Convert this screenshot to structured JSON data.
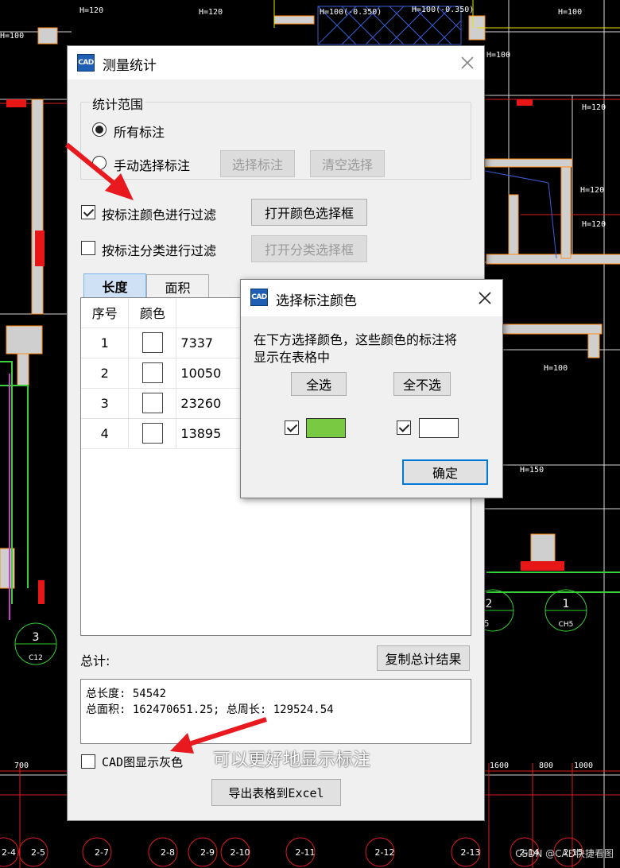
{
  "cad_labels": {
    "h120_a": "H=120",
    "h120_b": "H=120",
    "h100_a": "H=100(-0.350)",
    "h100_b": "H=100(-0.350)",
    "h100_c": "H=100",
    "h100_d": "H=100",
    "h100_e": "H=100",
    "h120_c": "H=120",
    "h120_d": "H=120",
    "h120_e": "H=120",
    "h100_f": "H=100",
    "h150": "H=150",
    "dim_700": "700",
    "dim_1600": "1600",
    "dim_800": "800",
    "dim_1000": "1000",
    "bubble_3": "3",
    "bubble_3_sub": "C12",
    "bubble_1": "1",
    "bubble_1_sub": "CH5",
    "bubble_2": "2",
    "bubble_2_sub": "5",
    "axes": [
      "2-4",
      "2-5",
      "2-7",
      "2-8",
      "2-9",
      "2-10",
      "2-11",
      "2-12",
      "2-13",
      "2-14",
      "2-15"
    ]
  },
  "main_dialog": {
    "icon_text": "CAD",
    "title": "测量统计",
    "scope_group_title": "统计范围",
    "radio_all": "所有标注",
    "radio_manual": "手动选择标注",
    "btn_select": "选择标注",
    "btn_clear": "清空选择",
    "check_color_filter": "按标注颜色进行过滤",
    "btn_open_color": "打开颜色选择框",
    "check_category_filter": "按标注分类进行过滤",
    "btn_open_category": "打开分类选择框",
    "tab_length": "长度",
    "tab_area": "面积",
    "table_headers": {
      "no": "序号",
      "color": "颜色",
      "length": "长度"
    },
    "rows": [
      {
        "no": "1",
        "length": "7337"
      },
      {
        "no": "2",
        "length": "10050"
      },
      {
        "no": "3",
        "length": "23260"
      },
      {
        "no": "4",
        "length": "13895"
      }
    ],
    "total_label": "总计:",
    "btn_copy_total": "复制总计结果",
    "summary_line1": "总长度: 54542",
    "summary_line2": "总面积: 162470651.25; 总周长: 129524.54",
    "check_gray": "CAD图显示灰色",
    "btn_export": "导出表格到Excel"
  },
  "color_dialog": {
    "title": "选择标注颜色",
    "instruction_line1": "在下方选择颜色，这些颜色的标注将",
    "instruction_line2": "显示在表格中",
    "btn_select_all": "全选",
    "btn_select_none": "全不选",
    "btn_ok": "确定",
    "swatch_green": "#7ac943",
    "swatch_white": "#ffffff"
  },
  "annotation": {
    "text": "可以更好地显示标注",
    "arrow_color": "#e8191f"
  },
  "watermark": "CSDN @CAD快捷看图"
}
